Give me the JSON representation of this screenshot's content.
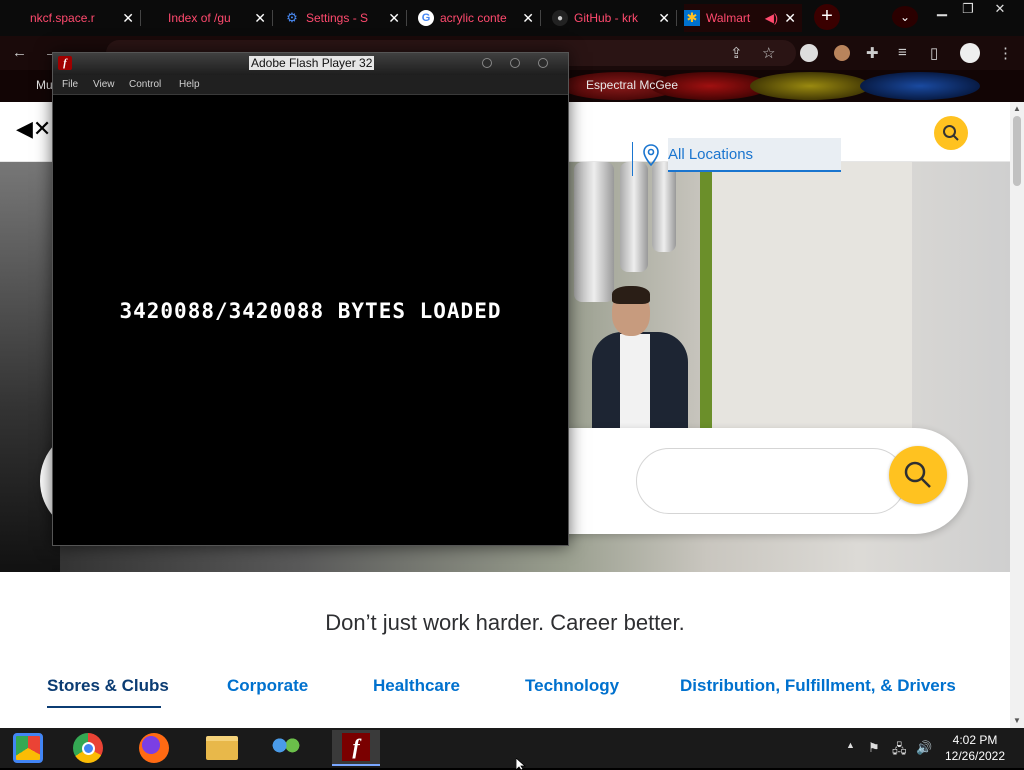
{
  "browser": {
    "tabs": [
      {
        "title": "nkcf.space.r",
        "icon": "site-icon"
      },
      {
        "title": "Index of /gu",
        "icon": "site-icon"
      },
      {
        "title": "Settings - S",
        "icon": "gear-icon"
      },
      {
        "title": "acrylic conte",
        "icon": "google-icon"
      },
      {
        "title": "GitHub - krk",
        "icon": "github-icon"
      },
      {
        "title": "Walmart",
        "icon": "walmart-spark-icon"
      }
    ],
    "bookmark_labels": [
      "Mu",
      "Espectral McGee"
    ]
  },
  "flash": {
    "title": "Adobe Flash Player 32",
    "menu": [
      "File",
      "View",
      "Control",
      "Help"
    ],
    "status": "3420088/3420088 BYTES LOADED"
  },
  "page": {
    "location_placeholder": "All Locations",
    "tagline": "Don’t just work harder. Career better.",
    "categories": [
      "Stores & Clubs",
      "Corporate",
      "Healthcare",
      "Technology",
      "Distribution, Fulfillment, & Drivers"
    ]
  },
  "taskbar": {
    "time": "4:02 PM",
    "date": "12/26/2022",
    "apps": [
      "chrome-remote-icon",
      "chrome-icon",
      "firefox-icon",
      "file-explorer-icon",
      "network-people-icon",
      "flash-player-icon"
    ]
  },
  "colors": {
    "walmart_yellow": "#ffc220",
    "walmart_blue": "#0071ce",
    "tab_text": "#ff4a6e"
  }
}
